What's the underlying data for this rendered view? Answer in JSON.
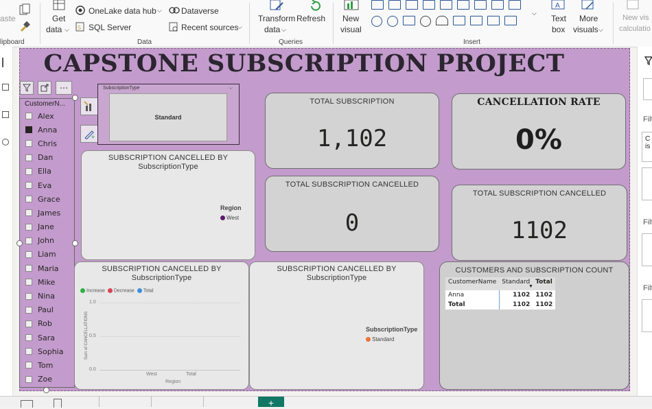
{
  "ribbon": {
    "clipboard": {
      "paste_label": "aste",
      "group_label": "lipboard"
    },
    "data": {
      "get_data_label": "Get",
      "get_data_label2": "data",
      "onelake_label": "OneLake data hub",
      "sql_label": "SQL Server",
      "dataverse_label": "Dataverse",
      "recent_label": "Recent sources",
      "group_label": "Data"
    },
    "queries": {
      "transform_label": "Transform",
      "transform_label2": "data",
      "refresh_label": "Refresh",
      "group_label": "Queries"
    },
    "insert": {
      "new_visual_label": "New",
      "new_visual_label2": "visual",
      "text_box_label": "Text",
      "text_box_label2": "box",
      "more_visuals_label": "More",
      "more_visuals_label2": "visuals",
      "group_label": "Insert"
    },
    "calc": {
      "label": "New vis",
      "label2": "calculatio"
    }
  },
  "report": {
    "title": "CAPSTONE SUBSCRIPTION PROJECT",
    "slicer_customer": {
      "header": "CustomerN...",
      "items": [
        {
          "label": "Alex",
          "checked": false
        },
        {
          "label": "Anna",
          "checked": true
        },
        {
          "label": "Chris",
          "checked": false
        },
        {
          "label": "Dan",
          "checked": false
        },
        {
          "label": "Ella",
          "checked": false
        },
        {
          "label": "Eva",
          "checked": false
        },
        {
          "label": "Grace",
          "checked": false
        },
        {
          "label": "James",
          "checked": false
        },
        {
          "label": "Jane",
          "checked": false
        },
        {
          "label": "John",
          "checked": false
        },
        {
          "label": "Liam",
          "checked": false
        },
        {
          "label": "Maria",
          "checked": false
        },
        {
          "label": "Mike",
          "checked": false
        },
        {
          "label": "Nina",
          "checked": false
        },
        {
          "label": "Paul",
          "checked": false
        },
        {
          "label": "Rob",
          "checked": false
        },
        {
          "label": "Sara",
          "checked": false
        },
        {
          "label": "Sophia",
          "checked": false
        },
        {
          "label": "Tom",
          "checked": false
        },
        {
          "label": "Zoe",
          "checked": false
        }
      ]
    },
    "slicer_type": {
      "header": "SubscriptionType",
      "value": "Standard"
    },
    "card_total": {
      "title": "TOTAL SUBSCRIPTION",
      "value": "1,102"
    },
    "card_rate": {
      "title": "CANCELLATION RATE",
      "value": "0%"
    },
    "card_cancelled_1": {
      "title": "TOTAL SUBSCRIPTION CANCELLED",
      "value": "0"
    },
    "card_cancelled_2": {
      "title": "TOTAL SUBSCRIPTION CANCELLED",
      "value": "1102"
    },
    "visual_a": {
      "title_line1": "SUBSCRIPTION CANCELLED BY",
      "title_line2": "SubscriptionType",
      "legend_title": "Region",
      "legend_items": [
        {
          "name": "West",
          "color": "#5b1c6a"
        }
      ]
    },
    "visual_b": {
      "title_line1": "SUBSCRIPTION CANCELLED BY",
      "title_line2": "SubscriptionType",
      "legend": [
        {
          "name": "Increase",
          "color": "#2fb144"
        },
        {
          "name": "Decrease",
          "color": "#d64550"
        },
        {
          "name": "Total",
          "color": "#3a8fe0"
        }
      ],
      "ylabel": "Sum of CANCELLATIONS",
      "xlabel": "Region",
      "yticks": [
        "1.0",
        "0.5",
        "0.0"
      ],
      "xticks": [
        "West",
        "Total"
      ]
    },
    "visual_c": {
      "title_line1": "SUBSCRIPTION CANCELLED BY",
      "title_line2": "SubscriptionType",
      "legend_title": "SubscriptionType",
      "legend_items": [
        {
          "name": "Standard",
          "color": "#e8743b"
        }
      ]
    },
    "matrix": {
      "title": "CUSTOMERS AND SUBSCRIPTION COUNT",
      "headers": [
        "CustomerName",
        "Standard",
        "Total"
      ],
      "rows": [
        {
          "name": "Anna",
          "standard": "1102",
          "total": "1102"
        }
      ],
      "total_row": {
        "name": "Total",
        "standard": "1102",
        "total": "1102"
      }
    }
  },
  "right_pane": {
    "labels": [
      "Filt",
      "Filt",
      "Filt"
    ],
    "snippet1": "C",
    "snippet2": "is"
  }
}
